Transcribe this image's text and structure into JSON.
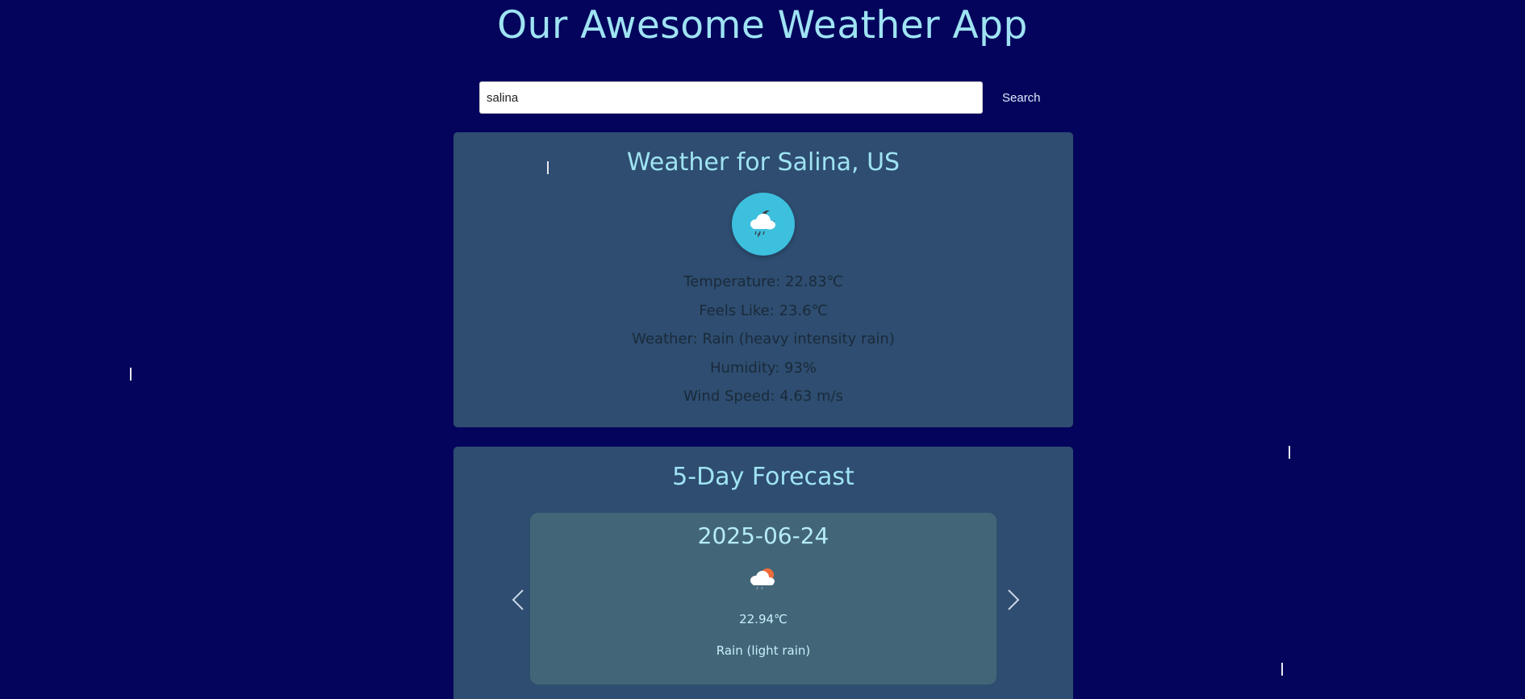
{
  "app": {
    "title": "Our Awesome Weather App"
  },
  "search": {
    "value": "salina",
    "button_label": "Search"
  },
  "current": {
    "heading": "Weather for Salina, US",
    "icon": "rain-cloud-night-icon",
    "details": [
      "Temperature: 22.83℃",
      "Feels Like: 23.6℃",
      "Weather: Rain (heavy intensity rain)",
      "Humidity: 93%",
      "Wind Speed: 4.63 m/s"
    ]
  },
  "forecast": {
    "heading": "5-Day Forecast",
    "item": {
      "date": "2025-06-24",
      "icon": "rain-cloud-sun-icon",
      "temp": "22.94℃",
      "description": "Rain (light rain)"
    },
    "prev_icon": "chevron-left-icon",
    "next_icon": "chevron-right-icon"
  },
  "colors": {
    "background": "#04045c",
    "title": "#9fe3f3",
    "card": "#2e4d70",
    "icon_circle": "#3cc0de",
    "forecast_item": "#426677"
  }
}
